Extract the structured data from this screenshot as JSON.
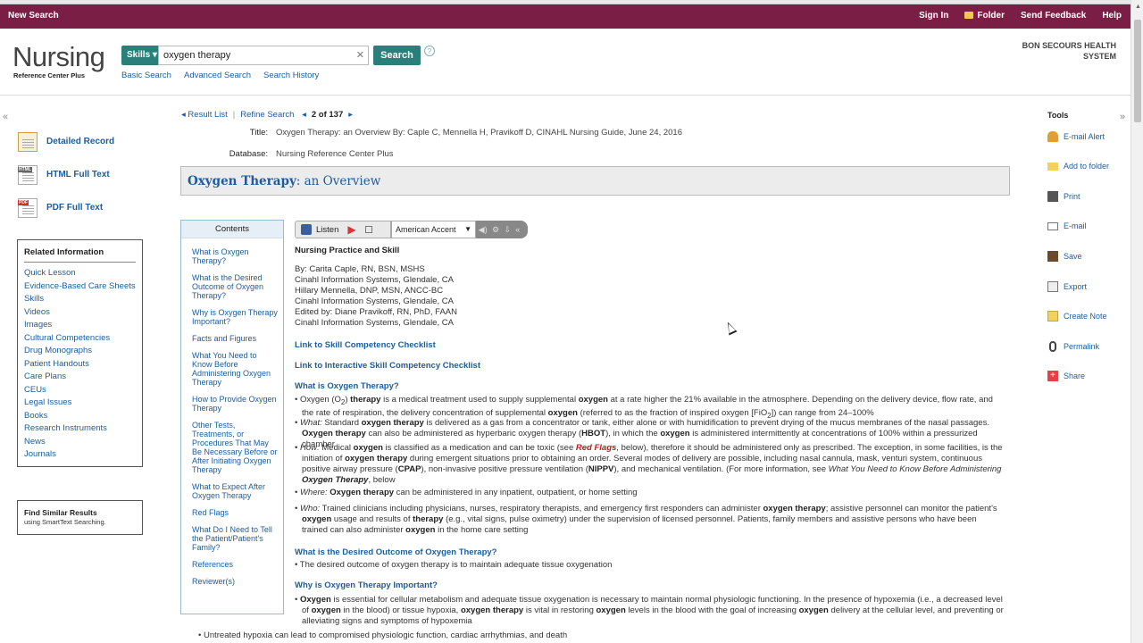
{
  "topbar": {
    "new_search": "New Search",
    "sign_in": "Sign In",
    "folder": "Folder",
    "send_feedback": "Send Feedback",
    "help": "Help"
  },
  "header": {
    "logo_main": "Nursing",
    "logo_sub": "Reference Center Plus",
    "skills_label": "Skills",
    "search_value": "oxygen therapy",
    "search_button": "Search",
    "help_q": "?",
    "basic_search": "Basic Search",
    "advanced_search": "Advanced Search",
    "search_history": "Search History",
    "org_line1": "BON SECOURS HEALTH",
    "org_line2": "SYSTEM"
  },
  "left": {
    "detailed_record": "Detailed Record",
    "html_full_text": "HTML Full Text",
    "pdf_full_text": "PDF Full Text",
    "related_title": "Related Information",
    "related_items": [
      "Quick Lesson",
      "Evidence-Based Care Sheets",
      "Skills",
      "Videos",
      "Images",
      "Cultural Competencies",
      "Drug Monographs",
      "Patient Handouts",
      "Care Plans",
      "CEUs",
      "Legal Issues",
      "Books",
      "Research Instruments",
      "News",
      "Journals"
    ],
    "similar_title": "Find Similar Results",
    "similar_sub": "using SmartText Searching."
  },
  "nav": {
    "result_list": "Result List",
    "refine_search": "Refine Search",
    "count": "2 of 137"
  },
  "record": {
    "title_label": "Title:",
    "title_value": "Oxygen Therapy: an Overview By: Caple C, Mennella H, Pravikoff D, CINAHL Nursing Guide, June 24, 2016",
    "database_label": "Database:",
    "database_value": "Nursing Reference Center Plus",
    "heading_bold": "Oxygen Therapy",
    "heading_rest": ": an Overview"
  },
  "contents": {
    "head": "Contents",
    "items": [
      "What is Oxygen Therapy?",
      "What is the Desired Outcome of Oxygen Therapy?",
      "Why is Oxygen Therapy Important?",
      "Facts and Figures",
      "What You Need to Know Before Administering Oxygen Therapy",
      "How to Provide Oxygen Therapy",
      "Other Tests, Treatments, or Procedures That May Be Necessary Before or After Initiating Oxygen Therapy",
      "What to Expect After Oxygen Therapy",
      "Red Flags",
      "What Do I Need to Tell the Patient/Patient's Family?",
      "References",
      "Reviewer(s)"
    ]
  },
  "listen": {
    "listen_label": "Listen",
    "accent": "American Accent"
  },
  "article": {
    "practice": "Nursing Practice and Skill",
    "authors": [
      "By: Carita Caple, RN, BSN, MSHS",
      "Cinahl Information Systems, Glendale, CA",
      "Hillary Mennella, DNP, MSN, ANCC-BC",
      "Cinahl Information Systems, Glendale, CA",
      "Edited by: Diane Pravikoff, RN, PhD, FAAN",
      "Cinahl Information Systems, Glendale, CA"
    ],
    "link1": "Link to Skill Competency Checklist",
    "link2": "Link to Interactive Skill Competency Checklist",
    "h_what": "What is Oxygen Therapy?",
    "h_outcome": "What is the Desired Outcome of Oxygen Therapy?",
    "outcome_text": "The desired outcome of oxygen therapy is to maintain adequate tissue oxygenation",
    "h_why": "Why is Oxygen Therapy Important?",
    "last_bullet": "Untreated hypoxia can lead to compromised physiologic function, cardiac arrhythmias, and death"
  },
  "tools": {
    "title": "Tools",
    "items": [
      "E-mail Alert",
      "Add to folder",
      "Print",
      "E-mail",
      "Save",
      "Export",
      "Create Note",
      "Permalink",
      "Share"
    ]
  },
  "colors": {
    "topbar": "#7b1e45",
    "accent_teal": "#2a7f7a",
    "link_blue": "#1d5c9c",
    "red_flags": "#b02020"
  }
}
